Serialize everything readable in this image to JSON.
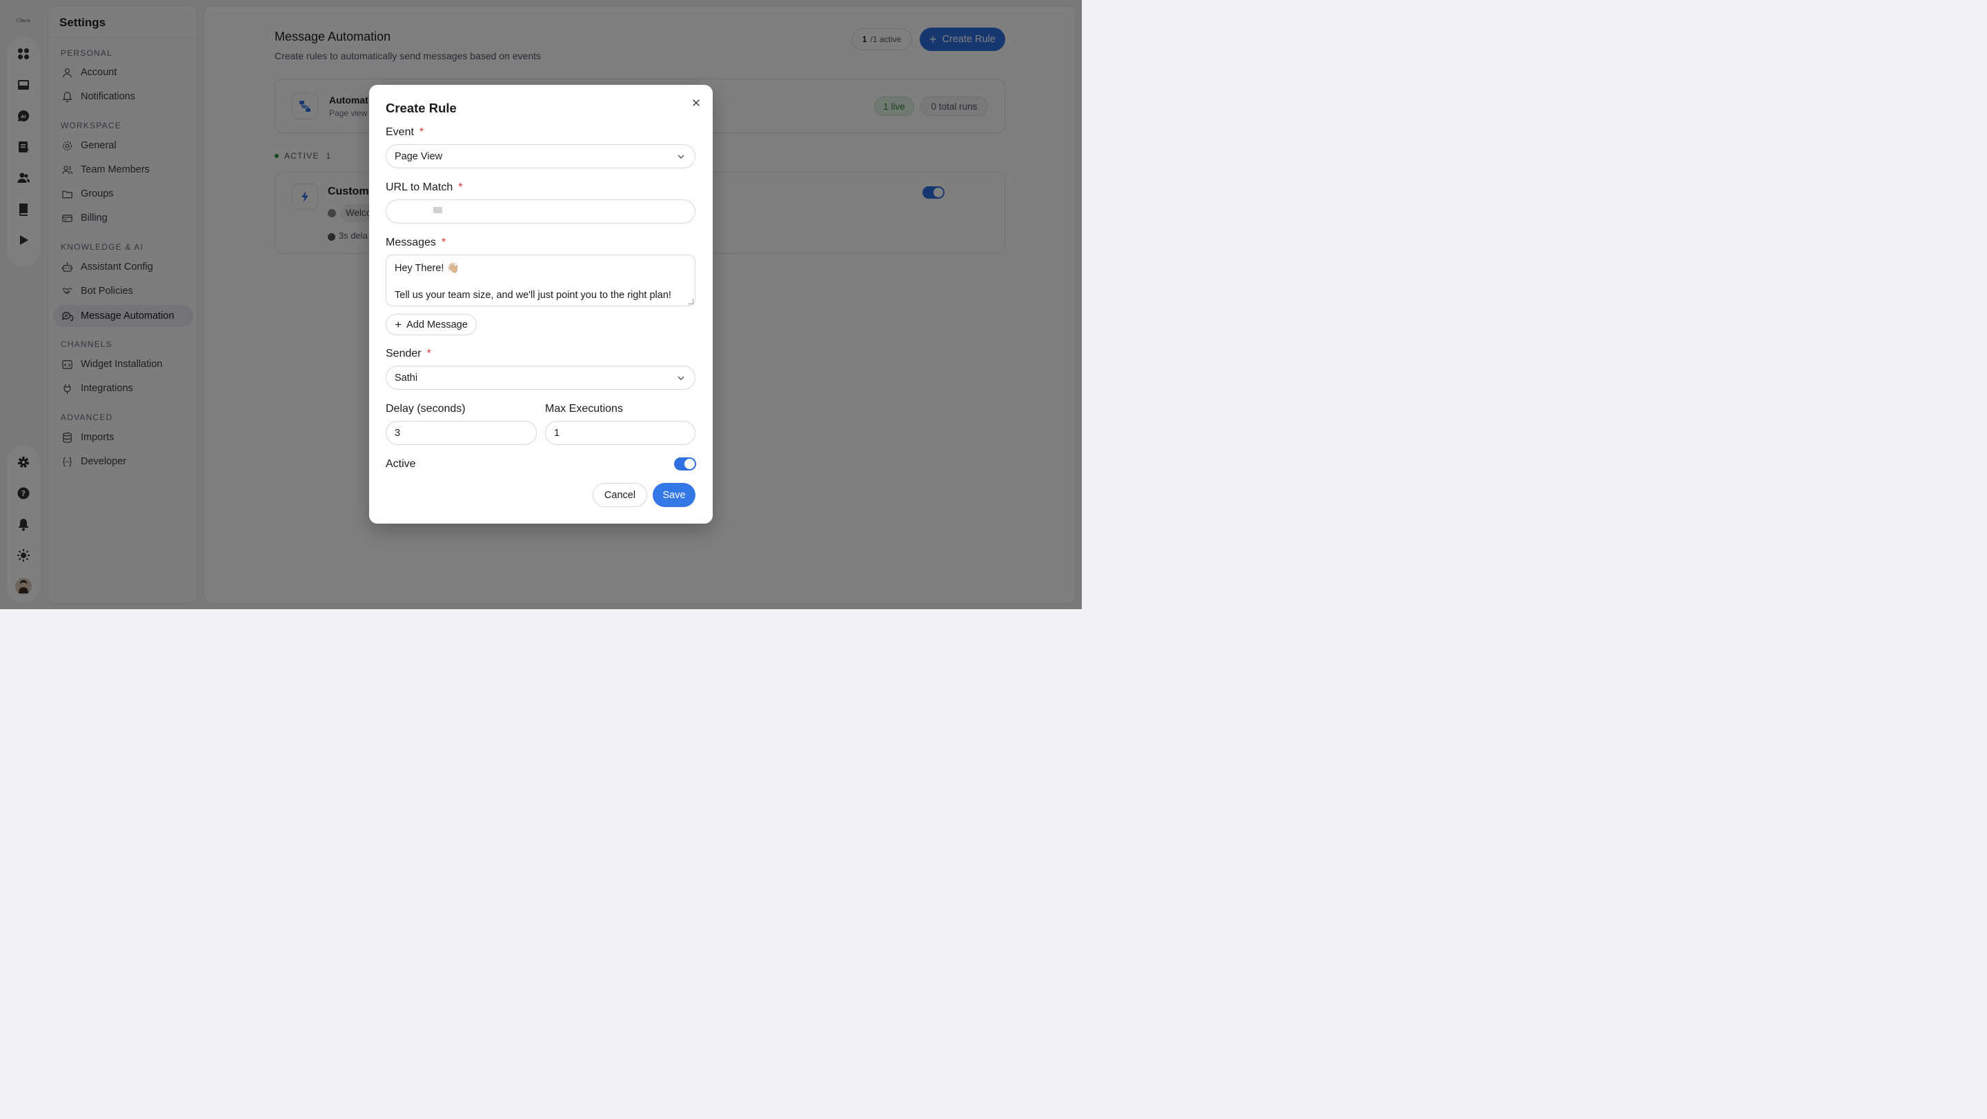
{
  "rail": {
    "logo_text": "Cinca",
    "top_icons": [
      "apps-icon",
      "inbox-icon",
      "ai-chat-icon",
      "tasks-icon",
      "contacts-icon",
      "book-icon",
      "play-icon"
    ],
    "bottom_icons": [
      "gear-icon",
      "help-icon",
      "bell-icon",
      "sun-icon",
      "avatar"
    ]
  },
  "sidebar": {
    "title": "Settings",
    "sections": {
      "personal": "PERSONAL",
      "workspace": "WORKSPACE",
      "knowledge": "KNOWLEDGE & AI",
      "channels": "CHANNELS",
      "advanced": "ADVANCED"
    },
    "items": {
      "account": "Account",
      "notifications": "Notifications",
      "general": "General",
      "team_members": "Team Members",
      "groups": "Groups",
      "billing": "Billing",
      "assistant_config": "Assistant Config",
      "bot_policies": "Bot Policies",
      "message_automation": "Message Automation",
      "widget_installation": "Widget Installation",
      "integrations": "Integrations",
      "imports": "Imports",
      "developer": "Developer"
    },
    "active_item": "message_automation"
  },
  "main": {
    "title": "Message Automation",
    "subtitle": "Create rules to automatically send messages based on events",
    "active_count": "1",
    "active_total": "/1 active",
    "create_label": "Create Rule",
    "summary": {
      "title": "Automat",
      "subtitle": "Page view",
      "live": "1 live",
      "runs": "0 total runs"
    },
    "active_section": {
      "label": "ACTIVE",
      "count": "1"
    },
    "rule": {
      "title": "Custom",
      "message_preview": "Welco",
      "delay": "3s dela",
      "enabled": true
    }
  },
  "modal": {
    "title": "Create Rule",
    "required_mark": "*",
    "event": {
      "label": "Event",
      "value": "Page View"
    },
    "url": {
      "label": "URL to Match",
      "value": ""
    },
    "messages": {
      "label": "Messages",
      "line1": "Hey There! 👋🏼",
      "line2": "Tell us your team size, and we'll just point you to the right plan!"
    },
    "add_message_label": "Add Message",
    "sender": {
      "label": "Sender",
      "value": "Sathi"
    },
    "delay": {
      "label": "Delay (seconds)",
      "value": "3"
    },
    "max_executions": {
      "label": "Max Executions",
      "value": "1"
    },
    "active": {
      "label": "Active",
      "enabled": true
    },
    "cancel_label": "Cancel",
    "save_label": "Save"
  },
  "colors": {
    "accent": "#2f6fe0",
    "save": "#3478e8",
    "required": "#e53935",
    "live_green": "#2e7d32"
  }
}
